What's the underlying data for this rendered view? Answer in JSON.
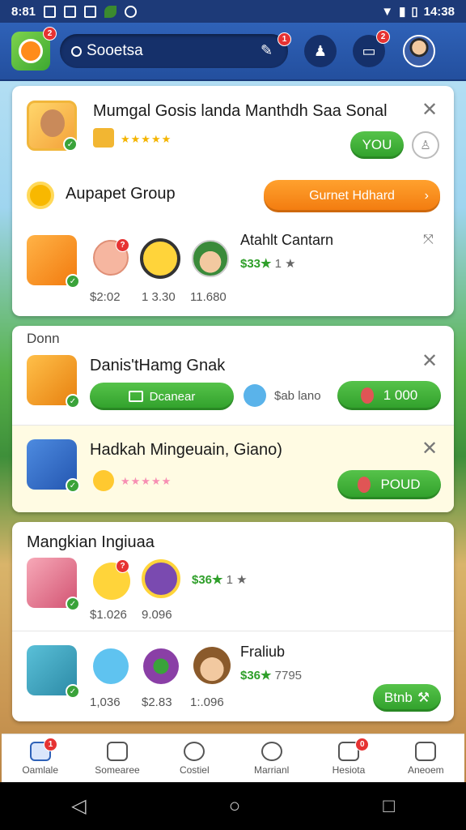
{
  "status": {
    "time": "8:81",
    "clock": "14:38"
  },
  "header": {
    "search_text": "Sooetsa",
    "notif_badge": "2",
    "inbox_badge": "2"
  },
  "card1": {
    "title": "Mumgal Gosis landa Manthdh Saa Sonal",
    "stars": "★★★★★",
    "you_button": "YOU"
  },
  "group": {
    "label": "Aupapet Group",
    "button": "Gurnet Hdhard"
  },
  "row1": {
    "name": "Atahlt Cantarn",
    "rating": "$33★",
    "count": "1 ★",
    "prices": [
      "$2:02",
      "1 3.30",
      "11.680"
    ]
  },
  "section_label": "Donn",
  "card2": {
    "title": "Danis'tHamg Gnak",
    "tag": "Dcanear",
    "price": "$ab lano",
    "button": "1 000"
  },
  "card3": {
    "title": "Hadkah Mingeuain, Giano)",
    "stars": "★★★★★",
    "button": "POUD"
  },
  "card4": {
    "title": "Mangkian Ingiuaa",
    "rating": "$36★",
    "count": "1 ★",
    "prices": [
      "$1.026",
      "9.096"
    ],
    "name2": "Fraliub",
    "rating2": "$36★",
    "count2": "7795",
    "prices2": [
      "1,036",
      "$2.83",
      "1:.096"
    ],
    "button": "Btnb"
  },
  "nav": {
    "items": [
      "Oamlale",
      "Somearee",
      "Costiel",
      "Marrianl",
      "Hesiota",
      "Aneoem"
    ]
  },
  "colors": {
    "accent": "#2f62b8",
    "green": "#2f9f2a",
    "orange": "#f27a0e"
  }
}
